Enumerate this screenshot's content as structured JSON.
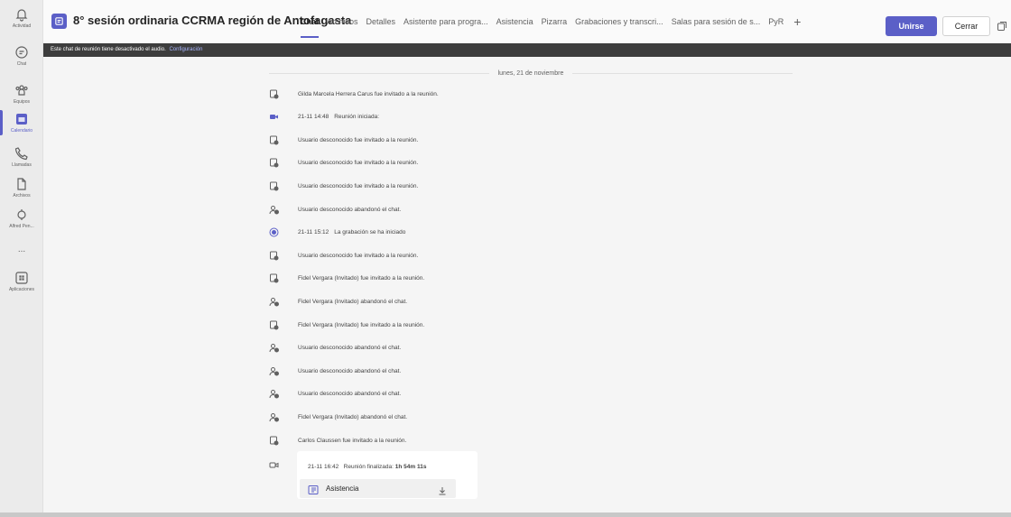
{
  "rail": [
    {
      "label": "Actividad",
      "icon": "bell-icon"
    },
    {
      "label": "Chat",
      "icon": "chat-icon"
    },
    {
      "label": "Equipos",
      "icon": "teams-icon"
    },
    {
      "label": "Calendario",
      "icon": "calendar-icon",
      "active": true
    },
    {
      "label": "Llamadas",
      "icon": "phone-icon"
    },
    {
      "label": "Archivos",
      "icon": "file-icon"
    },
    {
      "label": "Alfred Pen...",
      "icon": "app-icon"
    },
    {
      "label": "...",
      "icon": "more-icon"
    },
    {
      "label": "Aplicaciones",
      "icon": "apps-icon"
    }
  ],
  "header": {
    "title": "8° sesión ordinaria CCRMA región de Antofagasta",
    "tabs": [
      {
        "label": "Chat",
        "active": true
      },
      {
        "label": "Archivos"
      },
      {
        "label": "Detalles"
      },
      {
        "label": "Asistente para progra..."
      },
      {
        "label": "Asistencia"
      },
      {
        "label": "Pizarra"
      },
      {
        "label": "Grabaciones y transcri..."
      },
      {
        "label": "Salas para sesión de s..."
      },
      {
        "label": "PyR"
      }
    ],
    "plus": "+",
    "join_label": "Unirse",
    "close_label": "Cerrar"
  },
  "notice": {
    "text": "Este chat de reunión tiene desactivado el audio.",
    "link": "Configuración"
  },
  "chat": {
    "date": "lunes, 21 de noviembre",
    "events": [
      {
        "icon": "invite-icon",
        "text": "Gilda Marcela Herrera Carus fue invitado a la reunión."
      },
      {
        "icon": "video-icon",
        "time": "21-11 14:48",
        "text": "Reunión iniciada:"
      },
      {
        "icon": "invite-icon",
        "text": "Usuario desconocido fue invitado a la reunión."
      },
      {
        "icon": "invite-icon",
        "text": "Usuario desconocido fue invitado a la reunión."
      },
      {
        "icon": "invite-icon",
        "text": "Usuario desconocido fue invitado a la reunión."
      },
      {
        "icon": "leave-icon",
        "text": "Usuario desconocido abandonó el chat."
      },
      {
        "icon": "record-icon",
        "time": "21-11 15:12",
        "text": "La grabación se ha iniciado"
      },
      {
        "icon": "invite-icon",
        "text": "Usuario desconocido fue invitado a la reunión."
      },
      {
        "icon": "invite-icon",
        "text": "Fidel Vergara (Invitado) fue invitado a la reunión."
      },
      {
        "icon": "leave-icon",
        "text": "Fidel Vergara (Invitado) abandonó el chat."
      },
      {
        "icon": "invite-icon",
        "text": "Fidel Vergara (Invitado) fue invitado a la reunión."
      },
      {
        "icon": "leave-icon",
        "text": "Usuario desconocido abandonó el chat."
      },
      {
        "icon": "leave-icon",
        "text": "Usuario desconocido abandonó el chat."
      },
      {
        "icon": "leave-icon",
        "text": "Usuario desconocido abandonó el chat."
      },
      {
        "icon": "leave-icon",
        "text": "Fidel Vergara (Invitado) abandonó el chat."
      },
      {
        "icon": "invite-icon",
        "text": "Carlos Claussen fue invitado a la reunión."
      }
    ],
    "ended": {
      "time": "21-11 16:42",
      "text": "Reunión finalizada:",
      "duration": "1h 54m 11s",
      "attachment": "Asistencia"
    }
  },
  "colors": {
    "accent": "#5b5fc7",
    "notice_bg": "#3d3d3d"
  }
}
